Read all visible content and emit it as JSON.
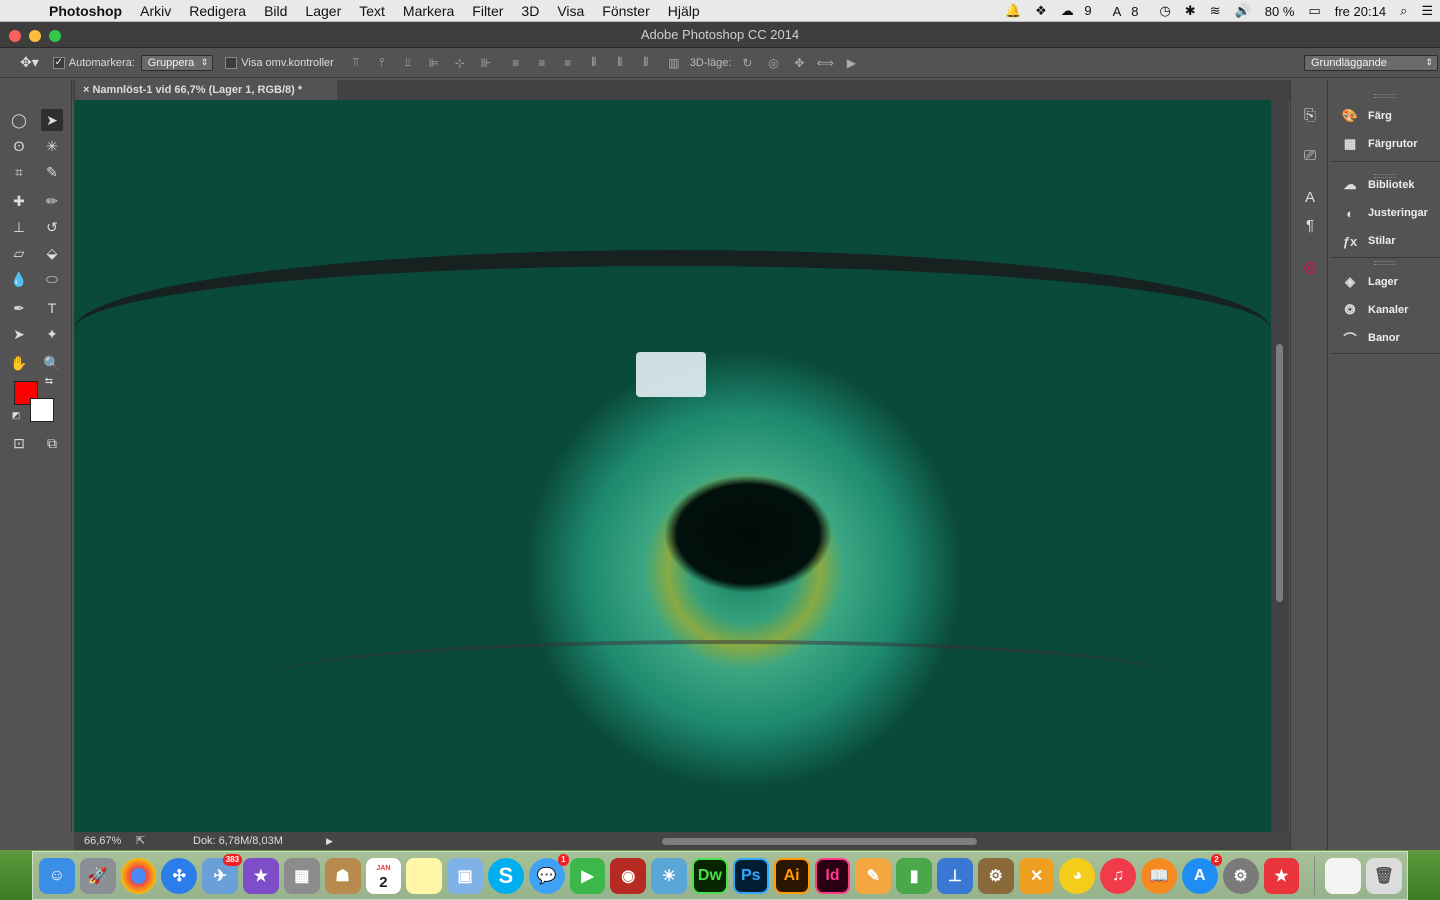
{
  "menubar": {
    "app": "Photoshop",
    "items": [
      "Arkiv",
      "Redigera",
      "Bild",
      "Lager",
      "Text",
      "Markera",
      "Filter",
      "3D",
      "Visa",
      "Fönster",
      "Hjälp"
    ],
    "status": {
      "adobe_count": "9",
      "font_count": "8",
      "battery": "80 %",
      "clock": "fre 20:14"
    }
  },
  "window": {
    "title": "Adobe Photoshop CC 2014"
  },
  "options": {
    "automark_label": "Automarkera:",
    "automark_value": "Gruppera",
    "show_transform_label": "Visa omv.kontroller",
    "mode3d_label": "3D-läge:",
    "workspace": "Grundläggande"
  },
  "document": {
    "tab_title": "Namnlöst-1 vid 66,7% (Lager 1, RGB/8) *",
    "zoom": "66,67%",
    "doc_size": "Dok: 6,78M/8,03M"
  },
  "colors": {
    "foreground": "#ff0000",
    "background": "#ffffff"
  },
  "panels": {
    "group1": [
      "Färg",
      "Färgrutor"
    ],
    "group2": [
      "Bibliotek",
      "Justeringar",
      "Stilar"
    ],
    "group3": [
      "Lager",
      "Kanaler",
      "Banor"
    ]
  },
  "dock": {
    "apps": [
      "Finder",
      "Launchpad",
      "Chrome",
      "Safari",
      "Mail",
      "iMovie",
      "Kalkylator",
      "Kontakter",
      "Kalender",
      "Anteckningar",
      "Förhandsvisning",
      "Skype",
      "Meddelanden",
      "FaceTime",
      "Photo Booth",
      "iPhoto",
      "Dreamweaver",
      "Photoshop",
      "Illustrator",
      "InDesign",
      "Pages",
      "Numbers",
      "Keynote",
      "Automator",
      "Cyberduck",
      "Adium",
      "iTunes",
      "iBooks",
      "App Store",
      "Systeminställningar",
      "Bokmärken",
      "Dokument",
      "Papperskorg"
    ],
    "calendar_day": "2",
    "calendar_month": "JAN",
    "mail_badge": "383",
    "messages_badge": "1",
    "appstore_badge": "2"
  }
}
